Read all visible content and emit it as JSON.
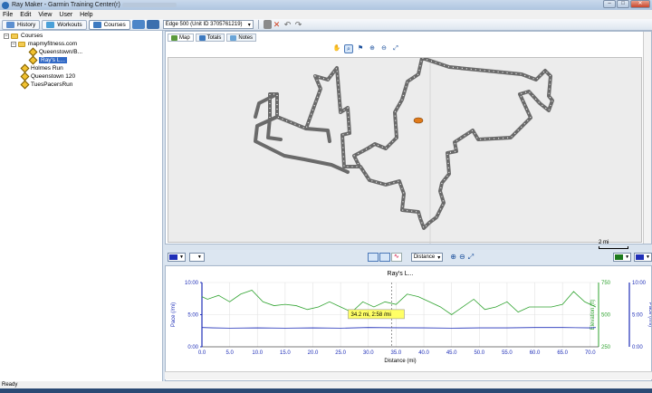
{
  "window": {
    "title": "Ray Maker - Garmin Training Center(r)"
  },
  "menu": [
    "File",
    "Edit",
    "View",
    "User",
    "Help"
  ],
  "toolbar": {
    "tabs": [
      {
        "label": "History",
        "color": "#5b8fd0"
      },
      {
        "label": "Workouts",
        "color": "#4aa0d8"
      },
      {
        "label": "Courses",
        "color": "#3d7ac0"
      }
    ],
    "device": "Edge 500 (Unit ID 3705761219)"
  },
  "sidebar": {
    "root": "Courses",
    "folder": "mapmyfitness.com",
    "items": [
      "Queenstown/B...",
      "Ray's L...",
      "Holmes Run",
      "Queenstown 120",
      "TuesPacersRun"
    ]
  },
  "map": {
    "tabs": [
      "Map",
      "Totals",
      "Notes"
    ],
    "scale_label": "2 mi"
  },
  "chart_toolbar": {
    "axis_mode": "Distance"
  },
  "chart_data": {
    "type": "line",
    "title": "Ray's L...",
    "xlabel": "Distance (mi)",
    "ylabel_left": "Pace (/mi)",
    "ylabel_right_outer": "Pace (/mi)",
    "ylabel_right_inner": "Elevation (ft)",
    "x_ticks": [
      "0.0",
      "5.0",
      "10.0",
      "15.0",
      "20.0",
      "25.0",
      "30.0",
      "35.0",
      "40.0",
      "45.0",
      "50.0",
      "55.0",
      "60.0",
      "65.0",
      "70.0"
    ],
    "y_left_ticks": [
      "10:00",
      "5:00",
      "0:00"
    ],
    "y_right_inner_ticks": [
      "750",
      "500",
      "250"
    ],
    "y_right_outer_ticks": [
      "10:00",
      "5:00",
      "0:00"
    ],
    "xlim": [
      0,
      71.5
    ],
    "grid": true,
    "cursor": {
      "x": 34.2,
      "label": "34.2 mi, 2:58 /mi"
    },
    "series": [
      {
        "color": "#2fa32f",
        "x": [
          0,
          1,
          3,
          5,
          7,
          9,
          11,
          13,
          15,
          17,
          19,
          21,
          23,
          25,
          27,
          29,
          31,
          33,
          35,
          37,
          39,
          41,
          43,
          45,
          47,
          49,
          51,
          53,
          55,
          57,
          59,
          61,
          63,
          65,
          67,
          69,
          71
        ],
        "values": [
          640,
          620,
          650,
          600,
          660,
          690,
          600,
          570,
          580,
          570,
          540,
          560,
          600,
          560,
          520,
          600,
          560,
          600,
          580,
          660,
          640,
          600,
          560,
          500,
          560,
          620,
          540,
          560,
          600,
          520,
          560,
          560,
          560,
          580,
          680,
          600,
          560
        ]
      },
      {
        "color": "#1f2fb8",
        "x": [
          0,
          2,
          5,
          10,
          15,
          20,
          25,
          30,
          34.2,
          40,
          45,
          50,
          55,
          60,
          65,
          70,
          71
        ],
        "pace_minutes": [
          3.0,
          2.95,
          2.9,
          2.95,
          2.9,
          2.95,
          2.9,
          3.0,
          2.97,
          2.95,
          2.9,
          2.95,
          2.95,
          3.0,
          3.0,
          2.95,
          3.0
        ]
      }
    ]
  },
  "status": "Ready",
  "colors": {
    "route": "#6a6a6a",
    "marker": "#e07a1a",
    "elevation": "#2fa32f",
    "pace": "#1f2fb8"
  }
}
